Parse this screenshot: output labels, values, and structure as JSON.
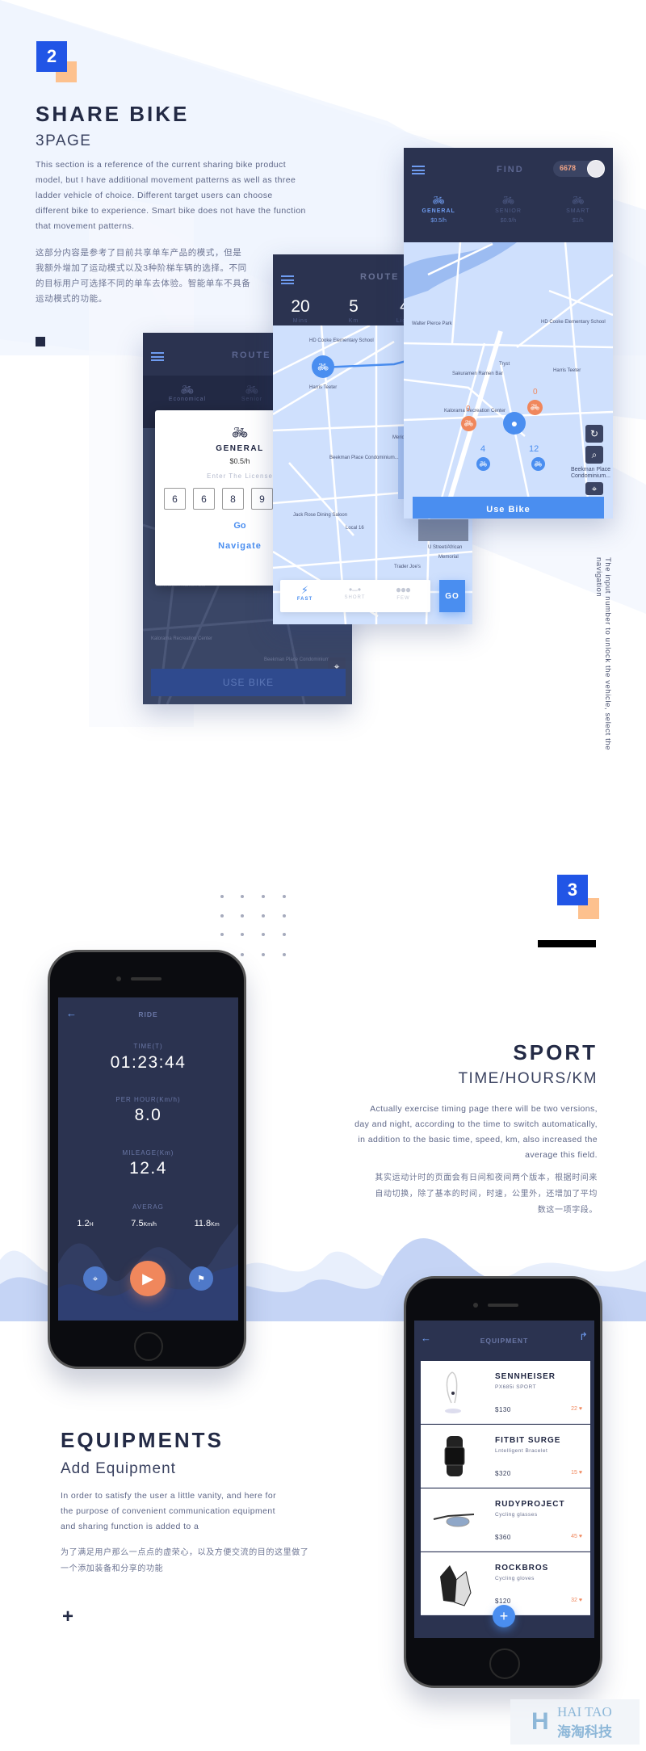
{
  "section2": {
    "badge": "2",
    "title": "SHARE BIKE",
    "subtitle": "3PAGE",
    "paragraph_lines": [
      "This section is a reference of the current sharing bike product",
      "model, but I have additional movement patterns as well as three",
      "ladder vehicle of choice. Different target users can choose",
      "different bike to experience. Smart bike does not have the function",
      "that movement patterns."
    ],
    "paragraph_cn_lines": [
      "这部分内容是参考了目前共享单车产品的模式，但是",
      "我额外增加了运动模式以及3种阶梯车辆的选择。不同",
      "的目标用户可选择不同的单车去体验。智能单车不具备",
      "运动模式的功能。"
    ],
    "side_note": "The input number to unlock the vehicle, select the navigation"
  },
  "route_dark": {
    "title": "ROUTE",
    "tabs": [
      {
        "label": "Economical",
        "icon": "bike-icon"
      },
      {
        "label": "Senior",
        "icon": "bike-icon"
      }
    ],
    "modal": {
      "type": "GENERAL",
      "price": "$0.5/h",
      "prompt": "Enter The License",
      "digits": [
        "6",
        "6",
        "8",
        "9"
      ],
      "go": "Go",
      "navigate": "Navigate"
    },
    "map_labels": [
      "Sakuramen Ramen Bar",
      "Kalorama Recreation Center",
      "Beekman Place Condominium..."
    ],
    "use_bike": "USE BIKE"
  },
  "route_map": {
    "title": "ROUTE",
    "stats": [
      {
        "value": "20",
        "unit": "Mins"
      },
      {
        "value": "5",
        "unit": "Km"
      },
      {
        "value": "4",
        "unit": "Light"
      }
    ],
    "map_labels": [
      "HD Cooke Elementary School",
      "Harris Teeter",
      "Meridian Hill Park",
      "Beekman Place Condominium...",
      "Jack Rose Dining Saloon",
      "Local 16",
      "Trader Joe's",
      "U Street/African",
      "Memorial"
    ],
    "modes": [
      {
        "label": "FAST",
        "icon": "lightning-icon",
        "active": true
      },
      {
        "label": "SHORT",
        "icon": "route-icon",
        "active": false
      },
      {
        "label": "FEW",
        "icon": "lights-icon",
        "active": false
      }
    ],
    "go": "GO"
  },
  "find": {
    "title": "FIND",
    "points": "6678",
    "tabs": [
      {
        "label": "GENERAL",
        "price": "$0.5/h",
        "active": true
      },
      {
        "label": "SENIOR",
        "price": "$0.9/h",
        "active": false
      },
      {
        "label": "SMART",
        "price": "$1/h",
        "active": false
      }
    ],
    "map_labels": [
      "Walter Pierce Park",
      "HD Cooke Elementary School",
      "Tryst",
      "Sakuramen Ramen Bar",
      "Harris Teeter",
      "Kalorama Recreation Center",
      "Beekman Place Condominium..."
    ],
    "pin_counts": [
      "0",
      "0",
      "4",
      "12"
    ],
    "use_bike": "Use Bike"
  },
  "section3": {
    "badge": "3",
    "title": "SPORT",
    "subtitle": "TIME/HOURS/KM",
    "paragraph_lines": [
      "Actually exercise timing page there will be two versions,",
      "day and night, according to the time to switch automatically,",
      "in addition to the basic time, speed, km, also increased the",
      "average this field."
    ],
    "paragraph_cn_lines": [
      "其实运动计时的页面会有日间和夜间两个版本，根据时间来",
      "自动切换，除了基本的时间，时速，公里外，还增加了平均",
      "数这一项字段。"
    ]
  },
  "ride": {
    "title": "RIDE",
    "time_label": "TIME(T)",
    "time": "01:23:44",
    "speed_label": "PER HOUR(Km/h)",
    "speed": "8.0",
    "mileage_label": "MILEAGE(Km)",
    "mileage": "12.4",
    "avg_label": "AVERAG",
    "avg": [
      {
        "value": "1.2",
        "unit": "H"
      },
      {
        "value": "7.5",
        "unit": "Km/h"
      },
      {
        "value": "11.8",
        "unit": "Km"
      }
    ]
  },
  "section4": {
    "title": "EQUIPMENTS",
    "subtitle": "Add Equipment",
    "paragraph_lines": [
      "In order to satisfy the user a little vanity, and here for",
      "the purpose of convenient communication equipment",
      "and sharing function is added to a"
    ],
    "paragraph_cn_lines": [
      "为了满足用户那么一点点的虚荣心，以及方便交流的目的这里做了",
      "一个添加装备和分享的功能"
    ]
  },
  "equipment": {
    "title": "EQUIPMENT",
    "items": [
      {
        "name": "SENNHEISER",
        "sub": "PX685i SPORT",
        "price": "$130",
        "likes": "22"
      },
      {
        "name": "FITBIT SURGE",
        "sub": "Lntelligent Bracelet",
        "price": "$320",
        "likes": "15"
      },
      {
        "name": "RUDYPROJECT",
        "sub": "Cycling glasses",
        "price": "$360",
        "likes": "45"
      },
      {
        "name": "ROCKBROS",
        "sub": "Cycling gloves",
        "price": "$120",
        "likes": "32"
      }
    ]
  },
  "watermark": {
    "en": "HAI TAO",
    "cn": "海淘科技"
  },
  "colors": {
    "accent": "#4a8ef0",
    "navy": "#2b3350",
    "orange": "#f0875c",
    "badge": "#2155e6",
    "badge_shadow": "#fdc18e"
  }
}
